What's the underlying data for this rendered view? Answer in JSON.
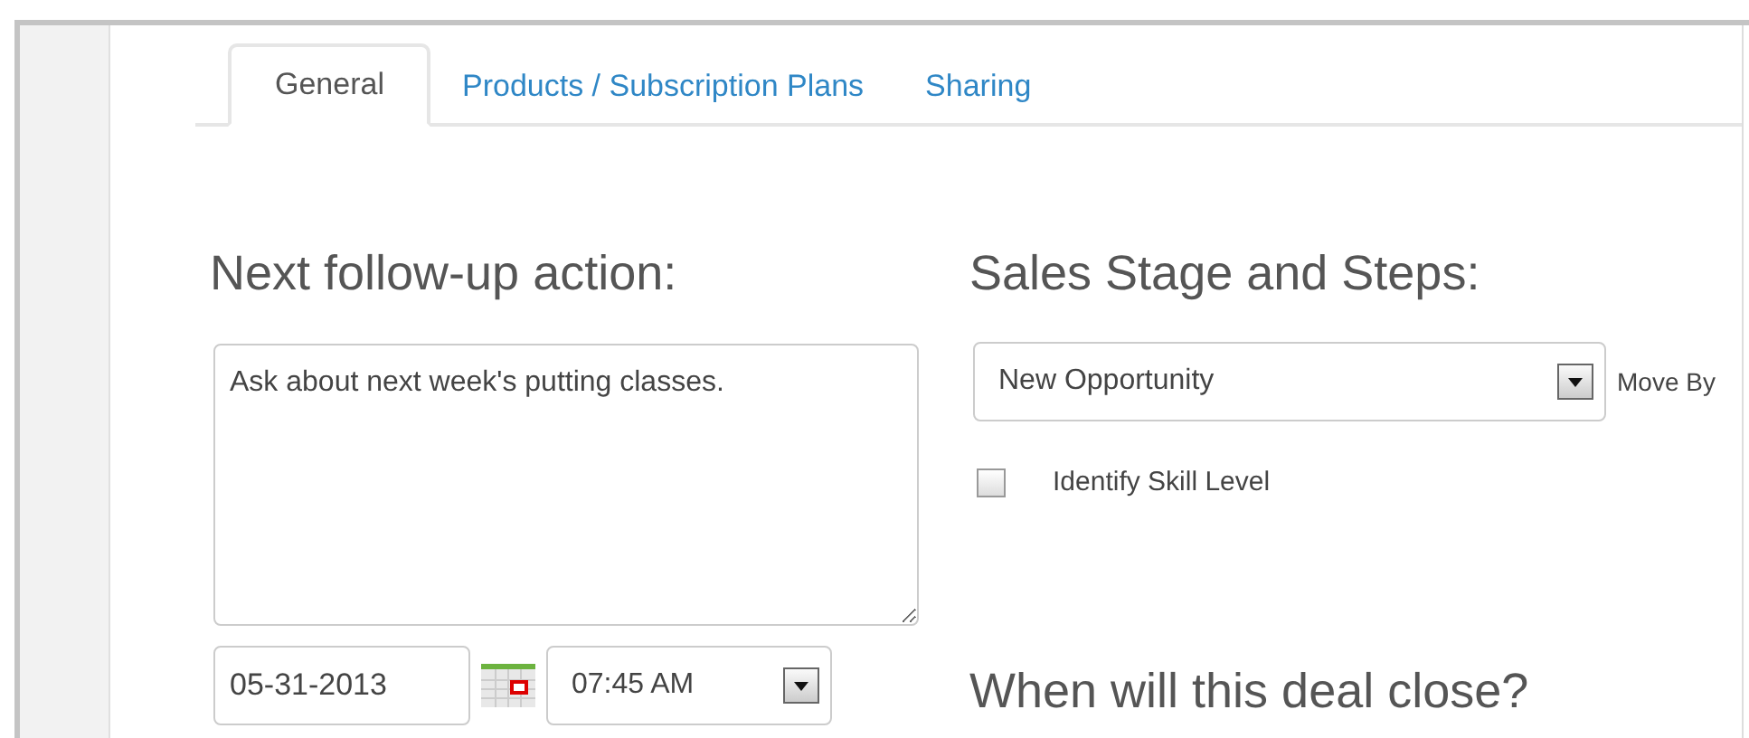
{
  "tabs": [
    {
      "label": "General",
      "selected": true
    },
    {
      "label": "Products / Subscription Plans",
      "selected": false
    },
    {
      "label": "Sharing",
      "selected": false
    }
  ],
  "follow_up": {
    "heading": "Next follow-up action:",
    "note": "Ask about next week's putting classes.",
    "date": "05-31-2013",
    "time": "07:45 AM"
  },
  "sales_stage": {
    "heading": "Sales Stage and Steps:",
    "stage": "New Opportunity",
    "move_by_label": "Move By",
    "steps": [
      {
        "label": "Identify Skill Level",
        "checked": false
      }
    ]
  },
  "close": {
    "heading": "When will this deal close?"
  }
}
